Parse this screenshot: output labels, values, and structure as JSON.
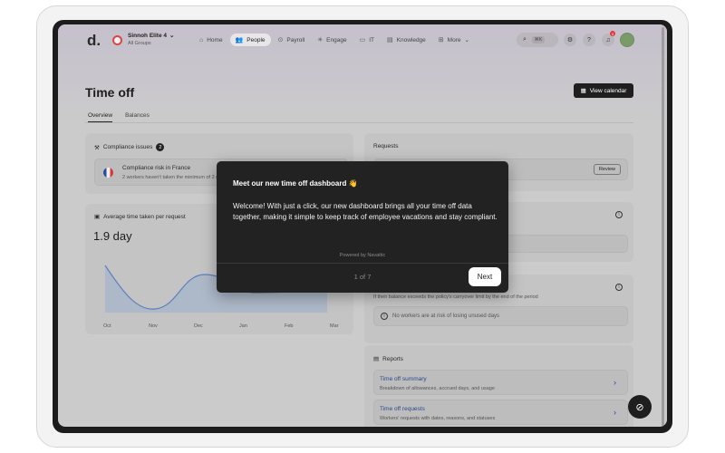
{
  "org": {
    "logo": "d.",
    "name": "Sinnoh Elite 4",
    "sub": "All Groups"
  },
  "nav": [
    {
      "label": "Home",
      "icon": "home-icon",
      "glyph": "⌂"
    },
    {
      "label": "People",
      "icon": "people-icon",
      "glyph": "👥"
    },
    {
      "label": "Payroll",
      "icon": "payroll-icon",
      "glyph": "⊙"
    },
    {
      "label": "Engage",
      "icon": "engage-icon",
      "glyph": "✳"
    },
    {
      "label": "IT",
      "icon": "laptop-icon",
      "glyph": "▭"
    },
    {
      "label": "Knowledge",
      "icon": "book-icon",
      "glyph": "▤"
    },
    {
      "label": "More",
      "icon": "grid-icon",
      "glyph": "⊞"
    }
  ],
  "search": {
    "shortcut": "⌘K"
  },
  "notifications": {
    "count": "3"
  },
  "page": {
    "title": "Time off",
    "view_calendar": "View calendar",
    "tabs": [
      "Overview",
      "Balances"
    ]
  },
  "compliance": {
    "title": "Compliance issues",
    "count": "2",
    "item_title": "Compliance risk in France",
    "item_sub": "2 workers haven't taken the minimum of 2 c"
  },
  "requests": {
    "title": "Requests",
    "review": "Review"
  },
  "avg": {
    "title": "Average time taken per request",
    "value": "1.9 day",
    "months": [
      "Oct",
      "Nov",
      "Dec",
      "Jan",
      "Feb",
      "Mar"
    ]
  },
  "risk": {
    "desc": "If their balance exceeds the policy's carryover limit by the end of the period",
    "empty": "No workers are at risk of losing unused days"
  },
  "reports": {
    "title": "Reports",
    "items": [
      {
        "title": "Time off summary",
        "sub": "Breakdown of allowances, accrued days, and usage"
      },
      {
        "title": "Time off requests",
        "sub": "Workers' requests with dates, reasons, and statuses"
      }
    ]
  },
  "modal": {
    "title": "Meet our new time off dashboard 👋",
    "body": "Welcome! With just a click, our new dashboard brings all your time off data together, making it simple to keep track of employee vacations and stay compliant.",
    "powered": "Powered by Navattic",
    "step": "1 of 7",
    "next": "Next"
  }
}
